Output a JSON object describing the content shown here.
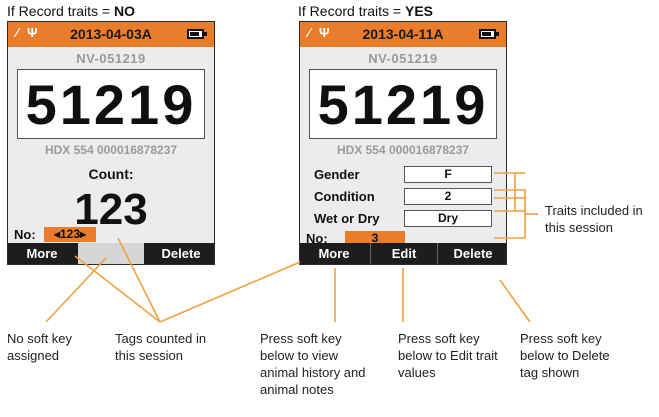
{
  "headings": {
    "left": {
      "prefix": "If Record traits = ",
      "value": "NO"
    },
    "right": {
      "prefix": "If Record traits = ",
      "value": "YES"
    }
  },
  "left_device": {
    "date": "2013-04-03A",
    "visual_id": "NV-051219",
    "big_number": "51219",
    "eid": "HDX 554 000016878237",
    "count_label": "Count:",
    "count_value": "123",
    "no_label": "No:",
    "no_value": "◂123▸",
    "softkeys": [
      "More",
      "",
      "Delete"
    ]
  },
  "right_device": {
    "date": "2013-04-11A",
    "visual_id": "NV-051219",
    "big_number": "51219",
    "eid": "HDX 554 000016878237",
    "traits": [
      {
        "label": "Gender",
        "value": "F"
      },
      {
        "label": "Condition",
        "value": "2"
      },
      {
        "label": "Wet or Dry",
        "value": "Dry"
      }
    ],
    "no_label": "No:",
    "no_value": "3",
    "softkeys": [
      "More",
      "Edit",
      "Delete"
    ]
  },
  "callouts": {
    "no_soft_key": "No soft key assigned",
    "tags_counted": "Tags counted in this session",
    "traits_included": "Traits included in this session",
    "press_more": "Press soft key below to view animal history and animal notes",
    "press_edit": "Press soft key below to Edit trait values",
    "press_delete": "Press soft key below to Delete tag shown"
  },
  "colors": {
    "accent": "#e97d2c",
    "softkey_bar": "#1d1d1d",
    "callout_line": "#f0a040"
  },
  "icons": [
    "no-gps-icon",
    "usb-icon",
    "battery-icon"
  ]
}
